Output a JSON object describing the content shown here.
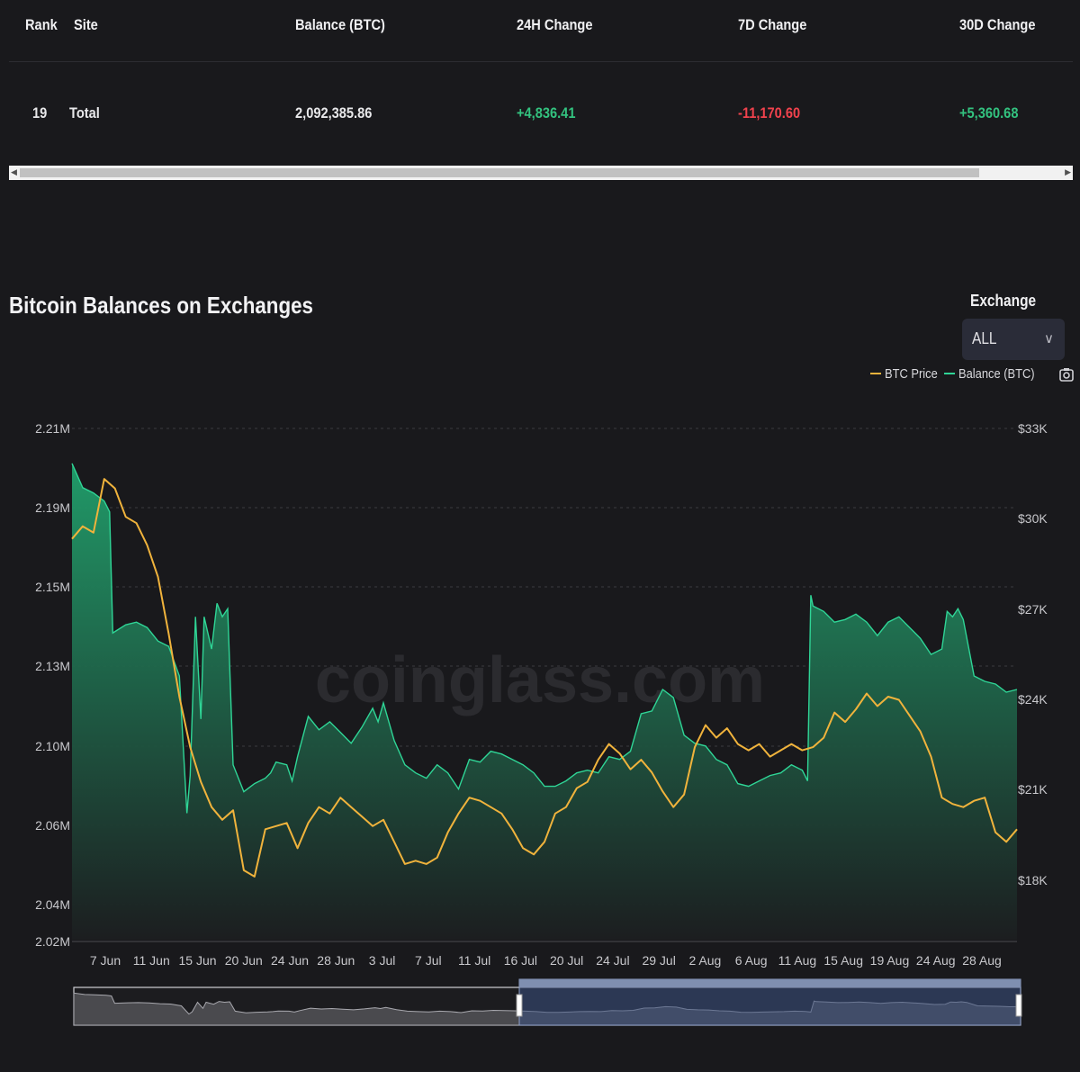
{
  "table": {
    "headers": [
      "Rank",
      "Site",
      "Balance (BTC)",
      "24H Change",
      "7D Change",
      "30D Change"
    ],
    "row": {
      "rank": "19",
      "site": "Total",
      "balance": "2,092,385.86",
      "change_24h": "+4,836.41",
      "change_7d": "-11,170.60",
      "change_30d": "+5,360.68"
    }
  },
  "chart_header": {
    "title": "Bitcoin Balances on Exchanges",
    "exchange_label": "Exchange",
    "exchange_value": "ALL",
    "legend": [
      {
        "name": "BTC Price",
        "color": "#f0b33c"
      },
      {
        "name": "Balance (BTC)",
        "color": "#2fd596"
      }
    ],
    "watermark": "coinglass.com"
  },
  "colors": {
    "background": "#19191c",
    "positive": "#33c27f",
    "negative": "#f0424d",
    "price_line": "#f0b33c",
    "balance_fill": "#1f8a5e"
  },
  "chart_data": {
    "type": "line",
    "x_ticks": [
      "7 Jun",
      "11 Jun",
      "15 Jun",
      "20 Jun",
      "24 Jun",
      "28 Jun",
      "3 Jul",
      "7 Jul",
      "11 Jul",
      "16 Jul",
      "20 Jul",
      "24 Jul",
      "29 Jul",
      "2 Aug",
      "6 Aug",
      "11 Aug",
      "15 Aug",
      "19 Aug",
      "24 Aug",
      "28 Aug"
    ],
    "y_left_ticks": [
      "2.21M",
      "2.19M",
      "2.15M",
      "2.13M",
      "2.10M",
      "2.06M",
      "2.04M",
      "2.02M"
    ],
    "y_right_ticks": [
      "$33K",
      "$30K",
      "$27K",
      "$24K",
      "$21K",
      "$18K"
    ],
    "x_domain": [
      0,
      88
    ],
    "y_left_domain": [
      2.02,
      2.21
    ],
    "y_right_domain": [
      16800,
      33000
    ],
    "grid": true,
    "legend_position": "top-right",
    "series": [
      {
        "name": "Balance (BTC)",
        "axis": "left",
        "color": "#2fd596",
        "points": [
          [
            0,
            2.197
          ],
          [
            1,
            2.188
          ],
          [
            2,
            2.186
          ],
          [
            3,
            2.183
          ],
          [
            3.5,
            2.179
          ],
          [
            3.8,
            2.134
          ],
          [
            5,
            2.137
          ],
          [
            6,
            2.138
          ],
          [
            7,
            2.136
          ],
          [
            8,
            2.131
          ],
          [
            9,
            2.129
          ],
          [
            10,
            2.118
          ],
          [
            10.7,
            2.067
          ],
          [
            11,
            2.081
          ],
          [
            11.5,
            2.14
          ],
          [
            12,
            2.102
          ],
          [
            12.3,
            2.14
          ],
          [
            13,
            2.128
          ],
          [
            13.5,
            2.145
          ],
          [
            14,
            2.14
          ],
          [
            14.5,
            2.143
          ],
          [
            15,
            2.085
          ],
          [
            16,
            2.075
          ],
          [
            17,
            2.078
          ],
          [
            18,
            2.08
          ],
          [
            18.5,
            2.082
          ],
          [
            19,
            2.086
          ],
          [
            20,
            2.085
          ],
          [
            20.5,
            2.079
          ],
          [
            21,
            2.088
          ],
          [
            22,
            2.103
          ],
          [
            23,
            2.098
          ],
          [
            24,
            2.101
          ],
          [
            25,
            2.097
          ],
          [
            26,
            2.093
          ],
          [
            27,
            2.099
          ],
          [
            28,
            2.106
          ],
          [
            28.5,
            2.101
          ],
          [
            29,
            2.108
          ],
          [
            30,
            2.094
          ],
          [
            31,
            2.085
          ],
          [
            32,
            2.082
          ],
          [
            33,
            2.08
          ],
          [
            34,
            2.085
          ],
          [
            35,
            2.082
          ],
          [
            36,
            2.076
          ],
          [
            37,
            2.087
          ],
          [
            38,
            2.086
          ],
          [
            39,
            2.09
          ],
          [
            40,
            2.089
          ],
          [
            41,
            2.087
          ],
          [
            42,
            2.085
          ],
          [
            43,
            2.082
          ],
          [
            44,
            2.077
          ],
          [
            45,
            2.077
          ],
          [
            46,
            2.079
          ],
          [
            47,
            2.082
          ],
          [
            48,
            2.083
          ],
          [
            49,
            2.082
          ],
          [
            50,
            2.088
          ],
          [
            51,
            2.087
          ],
          [
            52,
            2.09
          ],
          [
            53,
            2.104
          ],
          [
            54,
            2.105
          ],
          [
            55,
            2.113
          ],
          [
            56,
            2.11
          ],
          [
            57,
            2.096
          ],
          [
            58,
            2.093
          ],
          [
            59,
            2.092
          ],
          [
            60,
            2.087
          ],
          [
            61,
            2.085
          ],
          [
            62,
            2.078
          ],
          [
            63,
            2.077
          ],
          [
            64,
            2.079
          ],
          [
            65,
            2.081
          ],
          [
            66,
            2.082
          ],
          [
            67,
            2.085
          ],
          [
            68,
            2.083
          ],
          [
            68.5,
            2.079
          ],
          [
            68.8,
            2.148
          ],
          [
            69,
            2.144
          ],
          [
            70,
            2.142
          ],
          [
            71,
            2.138
          ],
          [
            72,
            2.139
          ],
          [
            73,
            2.141
          ],
          [
            74,
            2.138
          ],
          [
            75,
            2.133
          ],
          [
            76,
            2.138
          ],
          [
            77,
            2.14
          ],
          [
            78,
            2.136
          ],
          [
            79,
            2.132
          ],
          [
            80,
            2.126
          ],
          [
            81,
            2.128
          ],
          [
            81.5,
            2.142
          ],
          [
            82,
            2.14
          ],
          [
            82.5,
            2.143
          ],
          [
            83,
            2.139
          ],
          [
            84,
            2.118
          ],
          [
            85,
            2.116
          ],
          [
            86,
            2.115
          ],
          [
            87,
            2.112
          ],
          [
            88,
            2.113
          ]
        ]
      },
      {
        "name": "BTC Price",
        "axis": "right",
        "color": "#f0b33c",
        "points": [
          [
            0,
            29500
          ],
          [
            1,
            29900
          ],
          [
            2,
            29700
          ],
          [
            3,
            31400
          ],
          [
            4,
            31100
          ],
          [
            5,
            30200
          ],
          [
            6,
            30000
          ],
          [
            7,
            29300
          ],
          [
            8,
            28300
          ],
          [
            9,
            26500
          ],
          [
            10,
            24500
          ],
          [
            11,
            22900
          ],
          [
            12,
            21800
          ],
          [
            13,
            21000
          ],
          [
            14,
            20600
          ],
          [
            15,
            20900
          ],
          [
            16,
            19000
          ],
          [
            17,
            18800
          ],
          [
            18,
            20300
          ],
          [
            19,
            20400
          ],
          [
            20,
            20500
          ],
          [
            21,
            19700
          ],
          [
            22,
            20500
          ],
          [
            23,
            21000
          ],
          [
            24,
            20800
          ],
          [
            25,
            21300
          ],
          [
            26,
            21000
          ],
          [
            27,
            20700
          ],
          [
            28,
            20400
          ],
          [
            29,
            20600
          ],
          [
            30,
            19900
          ],
          [
            31,
            19200
          ],
          [
            32,
            19300
          ],
          [
            33,
            19200
          ],
          [
            34,
            19400
          ],
          [
            35,
            20200
          ],
          [
            36,
            20800
          ],
          [
            37,
            21300
          ],
          [
            38,
            21200
          ],
          [
            39,
            21000
          ],
          [
            40,
            20800
          ],
          [
            41,
            20300
          ],
          [
            42,
            19700
          ],
          [
            43,
            19500
          ],
          [
            44,
            19900
          ],
          [
            45,
            20800
          ],
          [
            46,
            21000
          ],
          [
            47,
            21600
          ],
          [
            48,
            21800
          ],
          [
            49,
            22500
          ],
          [
            50,
            23000
          ],
          [
            51,
            22700
          ],
          [
            52,
            22200
          ],
          [
            53,
            22500
          ],
          [
            54,
            22100
          ],
          [
            55,
            21500
          ],
          [
            56,
            21000
          ],
          [
            57,
            21400
          ],
          [
            58,
            22900
          ],
          [
            59,
            23600
          ],
          [
            60,
            23200
          ],
          [
            61,
            23500
          ],
          [
            62,
            23000
          ],
          [
            63,
            22800
          ],
          [
            64,
            23000
          ],
          [
            65,
            22600
          ],
          [
            66,
            22800
          ],
          [
            67,
            23000
          ],
          [
            68,
            22800
          ],
          [
            69,
            22900
          ],
          [
            70,
            23200
          ],
          [
            71,
            24000
          ],
          [
            72,
            23700
          ],
          [
            73,
            24100
          ],
          [
            74,
            24600
          ],
          [
            75,
            24200
          ],
          [
            76,
            24500
          ],
          [
            77,
            24400
          ],
          [
            78,
            23900
          ],
          [
            79,
            23400
          ],
          [
            80,
            22600
          ],
          [
            81,
            21300
          ],
          [
            82,
            21100
          ],
          [
            83,
            21000
          ],
          [
            84,
            21200
          ],
          [
            85,
            21300
          ],
          [
            86,
            20200
          ],
          [
            87,
            19900
          ],
          [
            88,
            20300
          ]
        ]
      }
    ]
  }
}
